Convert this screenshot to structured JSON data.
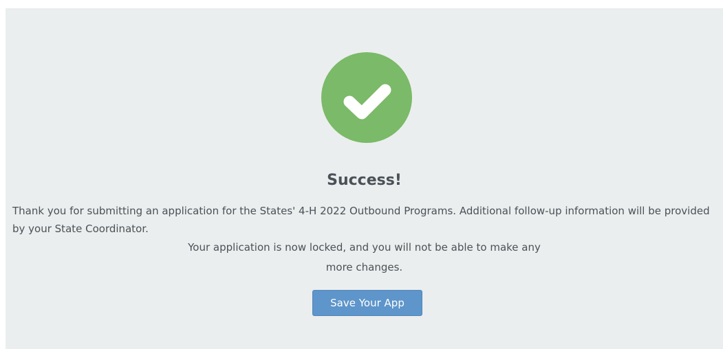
{
  "success": {
    "icon": "check-circle-icon",
    "title": "Success!",
    "message": "Thank you for submitting an application for the States' 4-H 2022 Outbound Programs. Additional follow-up information will be provided by your State Coordinator.",
    "locked_line_1": "Your application is now locked, and you will not be able to make any",
    "locked_line_2": "more changes.",
    "save_button_label": "Save Your App"
  },
  "colors": {
    "success_green": "#7aba68",
    "button_blue": "#5e95ca",
    "panel_background": "#ebeeee",
    "text": "#4a5157"
  }
}
